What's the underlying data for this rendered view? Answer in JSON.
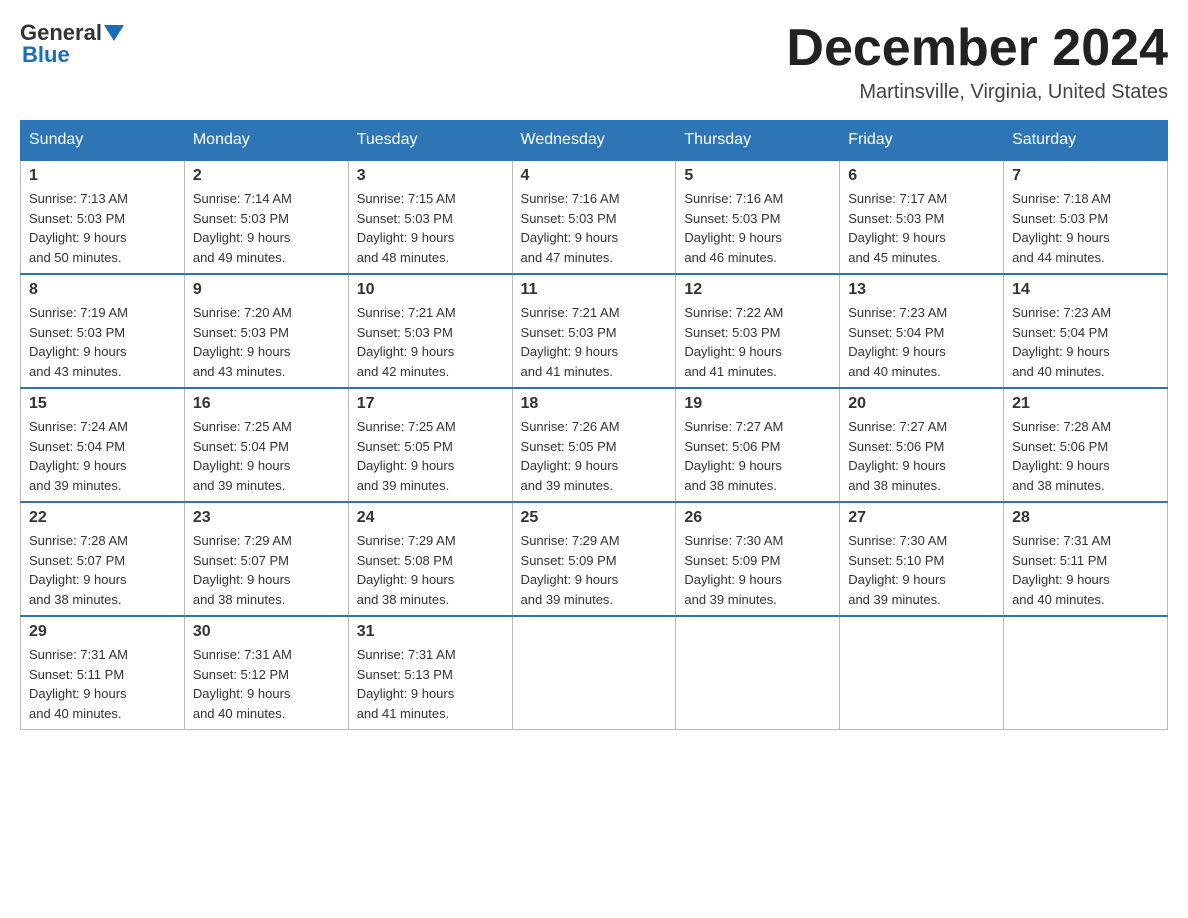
{
  "header": {
    "logo_general": "General",
    "logo_blue": "Blue",
    "month_title": "December 2024",
    "location": "Martinsville, Virginia, United States"
  },
  "columns": [
    "Sunday",
    "Monday",
    "Tuesday",
    "Wednesday",
    "Thursday",
    "Friday",
    "Saturday"
  ],
  "weeks": [
    [
      {
        "day": "1",
        "sunrise": "Sunrise: 7:13 AM",
        "sunset": "Sunset: 5:03 PM",
        "daylight": "Daylight: 9 hours",
        "minutes": "and 50 minutes."
      },
      {
        "day": "2",
        "sunrise": "Sunrise: 7:14 AM",
        "sunset": "Sunset: 5:03 PM",
        "daylight": "Daylight: 9 hours",
        "minutes": "and 49 minutes."
      },
      {
        "day": "3",
        "sunrise": "Sunrise: 7:15 AM",
        "sunset": "Sunset: 5:03 PM",
        "daylight": "Daylight: 9 hours",
        "minutes": "and 48 minutes."
      },
      {
        "day": "4",
        "sunrise": "Sunrise: 7:16 AM",
        "sunset": "Sunset: 5:03 PM",
        "daylight": "Daylight: 9 hours",
        "minutes": "and 47 minutes."
      },
      {
        "day": "5",
        "sunrise": "Sunrise: 7:16 AM",
        "sunset": "Sunset: 5:03 PM",
        "daylight": "Daylight: 9 hours",
        "minutes": "and 46 minutes."
      },
      {
        "day": "6",
        "sunrise": "Sunrise: 7:17 AM",
        "sunset": "Sunset: 5:03 PM",
        "daylight": "Daylight: 9 hours",
        "minutes": "and 45 minutes."
      },
      {
        "day": "7",
        "sunrise": "Sunrise: 7:18 AM",
        "sunset": "Sunset: 5:03 PM",
        "daylight": "Daylight: 9 hours",
        "minutes": "and 44 minutes."
      }
    ],
    [
      {
        "day": "8",
        "sunrise": "Sunrise: 7:19 AM",
        "sunset": "Sunset: 5:03 PM",
        "daylight": "Daylight: 9 hours",
        "minutes": "and 43 minutes."
      },
      {
        "day": "9",
        "sunrise": "Sunrise: 7:20 AM",
        "sunset": "Sunset: 5:03 PM",
        "daylight": "Daylight: 9 hours",
        "minutes": "and 43 minutes."
      },
      {
        "day": "10",
        "sunrise": "Sunrise: 7:21 AM",
        "sunset": "Sunset: 5:03 PM",
        "daylight": "Daylight: 9 hours",
        "minutes": "and 42 minutes."
      },
      {
        "day": "11",
        "sunrise": "Sunrise: 7:21 AM",
        "sunset": "Sunset: 5:03 PM",
        "daylight": "Daylight: 9 hours",
        "minutes": "and 41 minutes."
      },
      {
        "day": "12",
        "sunrise": "Sunrise: 7:22 AM",
        "sunset": "Sunset: 5:03 PM",
        "daylight": "Daylight: 9 hours",
        "minutes": "and 41 minutes."
      },
      {
        "day": "13",
        "sunrise": "Sunrise: 7:23 AM",
        "sunset": "Sunset: 5:04 PM",
        "daylight": "Daylight: 9 hours",
        "minutes": "and 40 minutes."
      },
      {
        "day": "14",
        "sunrise": "Sunrise: 7:23 AM",
        "sunset": "Sunset: 5:04 PM",
        "daylight": "Daylight: 9 hours",
        "minutes": "and 40 minutes."
      }
    ],
    [
      {
        "day": "15",
        "sunrise": "Sunrise: 7:24 AM",
        "sunset": "Sunset: 5:04 PM",
        "daylight": "Daylight: 9 hours",
        "minutes": "and 39 minutes."
      },
      {
        "day": "16",
        "sunrise": "Sunrise: 7:25 AM",
        "sunset": "Sunset: 5:04 PM",
        "daylight": "Daylight: 9 hours",
        "minutes": "and 39 minutes."
      },
      {
        "day": "17",
        "sunrise": "Sunrise: 7:25 AM",
        "sunset": "Sunset: 5:05 PM",
        "daylight": "Daylight: 9 hours",
        "minutes": "and 39 minutes."
      },
      {
        "day": "18",
        "sunrise": "Sunrise: 7:26 AM",
        "sunset": "Sunset: 5:05 PM",
        "daylight": "Daylight: 9 hours",
        "minutes": "and 39 minutes."
      },
      {
        "day": "19",
        "sunrise": "Sunrise: 7:27 AM",
        "sunset": "Sunset: 5:06 PM",
        "daylight": "Daylight: 9 hours",
        "minutes": "and 38 minutes."
      },
      {
        "day": "20",
        "sunrise": "Sunrise: 7:27 AM",
        "sunset": "Sunset: 5:06 PM",
        "daylight": "Daylight: 9 hours",
        "minutes": "and 38 minutes."
      },
      {
        "day": "21",
        "sunrise": "Sunrise: 7:28 AM",
        "sunset": "Sunset: 5:06 PM",
        "daylight": "Daylight: 9 hours",
        "minutes": "and 38 minutes."
      }
    ],
    [
      {
        "day": "22",
        "sunrise": "Sunrise: 7:28 AM",
        "sunset": "Sunset: 5:07 PM",
        "daylight": "Daylight: 9 hours",
        "minutes": "and 38 minutes."
      },
      {
        "day": "23",
        "sunrise": "Sunrise: 7:29 AM",
        "sunset": "Sunset: 5:07 PM",
        "daylight": "Daylight: 9 hours",
        "minutes": "and 38 minutes."
      },
      {
        "day": "24",
        "sunrise": "Sunrise: 7:29 AM",
        "sunset": "Sunset: 5:08 PM",
        "daylight": "Daylight: 9 hours",
        "minutes": "and 38 minutes."
      },
      {
        "day": "25",
        "sunrise": "Sunrise: 7:29 AM",
        "sunset": "Sunset: 5:09 PM",
        "daylight": "Daylight: 9 hours",
        "minutes": "and 39 minutes."
      },
      {
        "day": "26",
        "sunrise": "Sunrise: 7:30 AM",
        "sunset": "Sunset: 5:09 PM",
        "daylight": "Daylight: 9 hours",
        "minutes": "and 39 minutes."
      },
      {
        "day": "27",
        "sunrise": "Sunrise: 7:30 AM",
        "sunset": "Sunset: 5:10 PM",
        "daylight": "Daylight: 9 hours",
        "minutes": "and 39 minutes."
      },
      {
        "day": "28",
        "sunrise": "Sunrise: 7:31 AM",
        "sunset": "Sunset: 5:11 PM",
        "daylight": "Daylight: 9 hours",
        "minutes": "and 40 minutes."
      }
    ],
    [
      {
        "day": "29",
        "sunrise": "Sunrise: 7:31 AM",
        "sunset": "Sunset: 5:11 PM",
        "daylight": "Daylight: 9 hours",
        "minutes": "and 40 minutes."
      },
      {
        "day": "30",
        "sunrise": "Sunrise: 7:31 AM",
        "sunset": "Sunset: 5:12 PM",
        "daylight": "Daylight: 9 hours",
        "minutes": "and 40 minutes."
      },
      {
        "day": "31",
        "sunrise": "Sunrise: 7:31 AM",
        "sunset": "Sunset: 5:13 PM",
        "daylight": "Daylight: 9 hours",
        "minutes": "and 41 minutes."
      },
      null,
      null,
      null,
      null
    ]
  ]
}
